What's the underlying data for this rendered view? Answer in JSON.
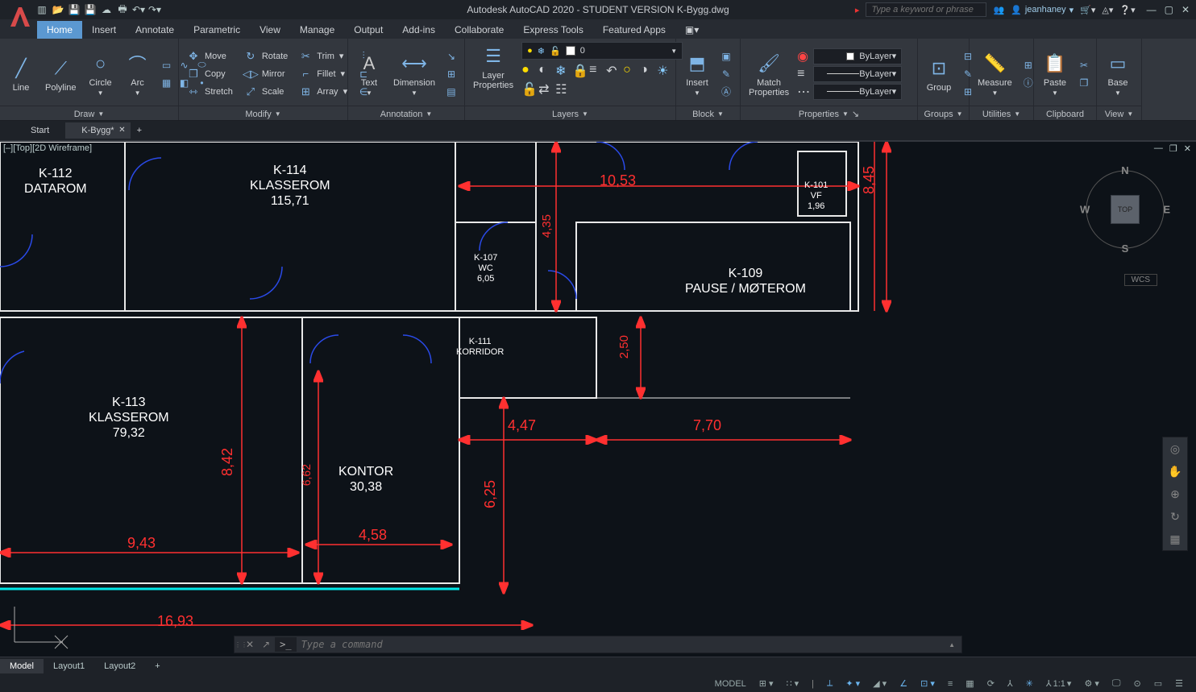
{
  "app": {
    "title": "Autodesk AutoCAD 2020 - STUDENT VERSION   K-Bygg.dwg"
  },
  "search": {
    "placeholder": "Type a keyword or phrase"
  },
  "user": {
    "name": "jeanhaney"
  },
  "menu": {
    "items": [
      "Home",
      "Insert",
      "Annotate",
      "Parametric",
      "View",
      "Manage",
      "Output",
      "Add-ins",
      "Collaborate",
      "Express Tools",
      "Featured Apps"
    ],
    "active": 0
  },
  "ribbon": {
    "draw": {
      "title": "Draw",
      "line": "Line",
      "polyline": "Polyline",
      "circle": "Circle",
      "arc": "Arc"
    },
    "modify": {
      "title": "Modify",
      "move": "Move",
      "rotate": "Rotate",
      "trim": "Trim",
      "copy": "Copy",
      "mirror": "Mirror",
      "fillet": "Fillet",
      "stretch": "Stretch",
      "scale": "Scale",
      "array": "Array"
    },
    "annotation": {
      "title": "Annotation",
      "text": "Text",
      "dimension": "Dimension"
    },
    "layers": {
      "title": "Layers",
      "props": "Layer\nProperties",
      "current": "0"
    },
    "block": {
      "title": "Block",
      "insert": "Insert"
    },
    "properties": {
      "title": "Properties",
      "match": "Match\nProperties",
      "bylayer": "ByLayer"
    },
    "groups": {
      "title": "Groups",
      "group": "Group"
    },
    "utilities": {
      "title": "Utilities",
      "measure": "Measure"
    },
    "clipboard": {
      "title": "Clipboard",
      "paste": "Paste"
    },
    "view": {
      "title": "View",
      "base": "Base"
    }
  },
  "filetabs": {
    "items": [
      "Start",
      "K-Bygg*"
    ],
    "active": 1
  },
  "viewport": {
    "label": "[–][Top][2D Wireframe]"
  },
  "compass": {
    "n": "N",
    "s": "S",
    "e": "E",
    "w": "W",
    "top": "TOP"
  },
  "wcs": "WCS",
  "rooms": {
    "k112": "K-112\nDATAROM",
    "k114": "K-114\nKLASSEROM\n115,71",
    "k101": "K-101\nVF\n1,96",
    "k107": "K-107\nWC\n6,05",
    "k109": "K-109\nPAUSE / MØTEROM",
    "k111": "K-111\nKORRIDOR",
    "k113": "K-113\nKLASSEROM\n79,32",
    "kontor": "KONTOR\n30,38"
  },
  "dims": {
    "d1053": "10,53",
    "d845": "8,45",
    "d435": "4,35",
    "d447": "4,47",
    "d770": "7,70",
    "d250": "2,50",
    "d842": "8,42",
    "d662": "6,62",
    "d625": "6,25",
    "d458": "4,58",
    "d943": "9,43",
    "d1693": "16,93"
  },
  "cmd": {
    "placeholder": "Type a command",
    "prompt": ">_"
  },
  "layouts": {
    "items": [
      "Model",
      "Layout1",
      "Layout2"
    ],
    "active": 0
  },
  "status": {
    "model": "MODEL",
    "scale": "1:1"
  }
}
